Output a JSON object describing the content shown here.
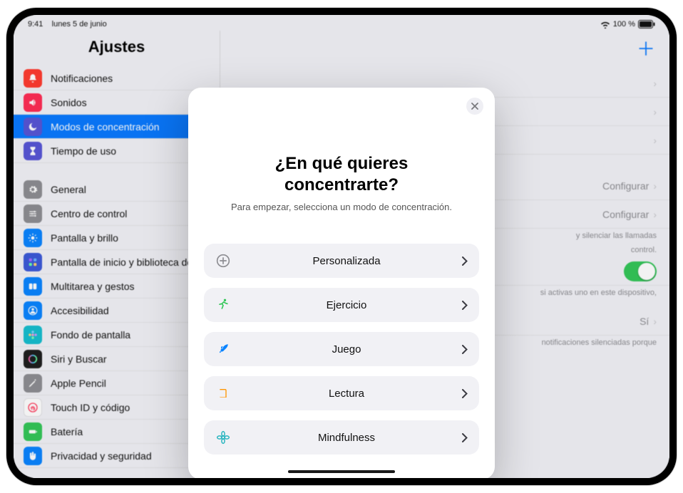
{
  "status": {
    "time": "9:41",
    "date": "lunes 5 de junio",
    "battery": "100 %"
  },
  "sidebar": {
    "title": "Ajustes",
    "items": [
      {
        "label": "Notificaciones",
        "icon_bg": "#ff3b30",
        "svg": "bell"
      },
      {
        "label": "Sonidos",
        "icon_bg": "#ff2d55",
        "svg": "speaker"
      },
      {
        "label": "Modos de concentración",
        "icon_bg": "#5856d6",
        "svg": "moon",
        "selected": true
      },
      {
        "label": "Tiempo de uso",
        "icon_bg": "#5856d6",
        "svg": "hourglass"
      }
    ],
    "items2": [
      {
        "label": "General",
        "icon_bg": "#8e8e93",
        "svg": "gear"
      },
      {
        "label": "Centro de control",
        "icon_bg": "#8e8e93",
        "svg": "sliders"
      },
      {
        "label": "Pantalla y brillo",
        "icon_bg": "#0a84ff",
        "svg": "sun"
      },
      {
        "label": "Pantalla de inicio y biblioteca de apps",
        "icon_bg": "#3d5ad8",
        "svg": "grid"
      },
      {
        "label": "Multitarea y gestos",
        "icon_bg": "#0a84ff",
        "svg": "multitask"
      },
      {
        "label": "Accesibilidad",
        "icon_bg": "#0a84ff",
        "svg": "person"
      },
      {
        "label": "Fondo de pantalla",
        "icon_bg": "#17becf",
        "svg": "flower"
      },
      {
        "label": "Siri y Buscar",
        "icon_bg": "#1f1f1f",
        "svg": "siri"
      },
      {
        "label": "Apple Pencil",
        "icon_bg": "#8e8e93",
        "svg": "pencil"
      },
      {
        "label": "Touch ID y código",
        "icon_bg": "#ffffff",
        "svg": "touchid",
        "ring": true
      },
      {
        "label": "Batería",
        "icon_bg": "#34c759",
        "svg": "battery"
      },
      {
        "label": "Privacidad y seguridad",
        "icon_bg": "#0a84ff",
        "svg": "hand"
      }
    ]
  },
  "content": {
    "add": "＋",
    "rows": [
      {
        "right": "",
        "chev": true
      },
      {
        "right": "",
        "chev": true
      },
      {
        "right": "",
        "chev": true
      }
    ],
    "configure": "Configurar",
    "note1": "y silenciar las llamadas",
    "note1b": "control.",
    "note2": "si activas uno en este dispositivo,",
    "si": "Sí",
    "note3": "notificaciones silenciadas porque"
  },
  "modal": {
    "title_l1": "¿En qué quieres",
    "title_l2": "concentrarte?",
    "subtitle": "Para empezar, selecciona un modo de concentración.",
    "options": [
      {
        "label": "Personalizada",
        "color": "#8e8e93",
        "icon": "plus"
      },
      {
        "label": "Ejercicio",
        "color": "#34c759",
        "icon": "run"
      },
      {
        "label": "Juego",
        "color": "#0a84ff",
        "icon": "rocket"
      },
      {
        "label": "Lectura",
        "color": "#ff9500",
        "icon": "book"
      },
      {
        "label": "Mindfulness",
        "color": "#2cb6c0",
        "icon": "lotus"
      }
    ]
  }
}
